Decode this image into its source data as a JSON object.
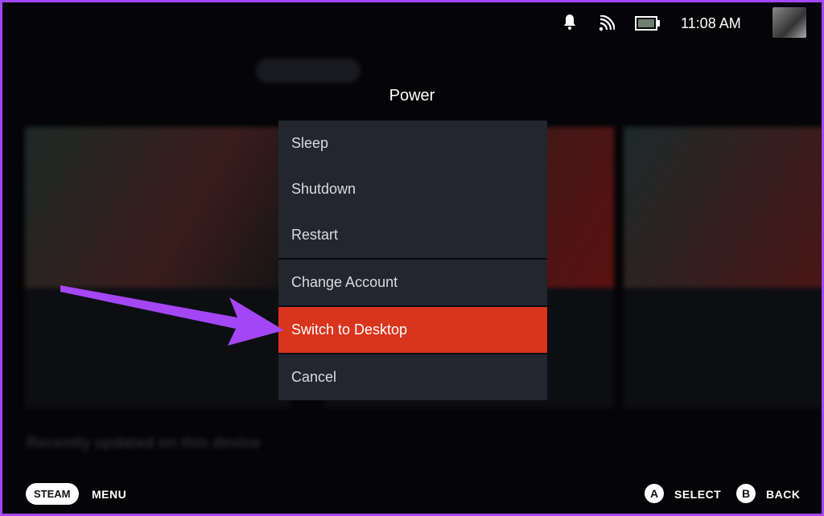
{
  "status_bar": {
    "time": "11:08 AM",
    "icons": [
      "bell-icon",
      "wifi-icon",
      "battery-icon"
    ]
  },
  "background": {
    "section_title": "Recently updated on this device"
  },
  "dialog": {
    "title": "Power",
    "items": [
      {
        "label": "Sleep"
      },
      {
        "label": "Shutdown"
      },
      {
        "label": "Restart"
      },
      {
        "label": "Change Account"
      },
      {
        "label": "Switch to Desktop",
        "selected": true
      },
      {
        "label": "Cancel"
      }
    ]
  },
  "footer": {
    "steam": "STEAM",
    "menu": "MENU",
    "a": "A",
    "select": "SELECT",
    "b": "B",
    "back": "BACK"
  },
  "colors": {
    "selected": "#d9341c",
    "annotation_arrow": "#a347f5",
    "border": "#a347f5"
  }
}
